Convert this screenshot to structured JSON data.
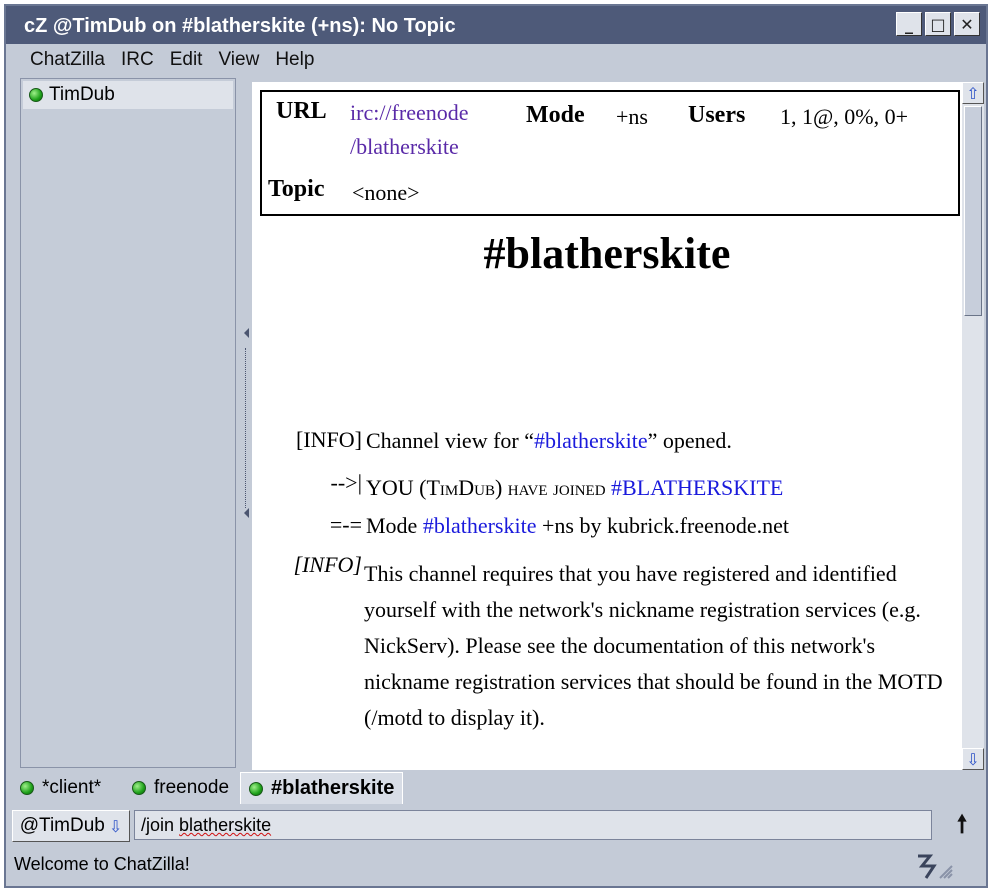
{
  "window": {
    "title": "cZ @TimDub on #blatherskite (+ns): No Topic",
    "minimize_glyph": "_",
    "maximize_glyph": "□",
    "close_glyph": "✕"
  },
  "menu": {
    "items": [
      "ChatZilla",
      "IRC",
      "Edit",
      "View",
      "Help"
    ]
  },
  "userlist": {
    "users": [
      {
        "name": "TimDub",
        "status": "op"
      }
    ]
  },
  "channel_info": {
    "url_label": "URL",
    "url_line1": "irc://freenode",
    "url_line2": "/blatherskite",
    "mode_label": "Mode",
    "mode_value": "+ns",
    "users_label": "Users",
    "users_value": "1, 1@, 0%, 0+",
    "topic_label": "Topic",
    "topic_value": "<none>"
  },
  "channel_title": "#blatherskite",
  "messages": {
    "m1": {
      "type": "[INFO]",
      "text_pre": "Channel view for “",
      "channel": "#blatherskite",
      "text_post": "” opened."
    },
    "m2": {
      "type": "-->|",
      "text_pre": "YOU (TimDub) have joined ",
      "channel": "#BLATHERSKITE"
    },
    "m3": {
      "type": "=-=",
      "text_pre": "Mode ",
      "channel": "#blatherskite",
      "text_post": " +ns by kubrick.freenode.net"
    },
    "m4": {
      "type": "[INFO]",
      "text": "This channel requires that you have registered and identified yourself with the network's nickname registration services (e.g. NickServ). Please see the documentation of this network's nickname registration services that should be found in the MOTD (/motd to display it)."
    }
  },
  "tabs": [
    {
      "label": "*client*",
      "active": false
    },
    {
      "label": "freenode",
      "active": false
    },
    {
      "label": "#blatherskite",
      "active": true
    }
  ],
  "input": {
    "nick": "@TimDub",
    "value_prefix": "/join ",
    "value_word": "blatherskite",
    "send_glyph": "🠕"
  },
  "status": {
    "text": "Welcome to ChatZilla!"
  },
  "colors": {
    "titlebar": "#4e5a79",
    "chrome": "#c4cbd7",
    "link": "#5a2aa8",
    "channel_link": "#1a1adc",
    "status_dot": "#1fa21b"
  }
}
